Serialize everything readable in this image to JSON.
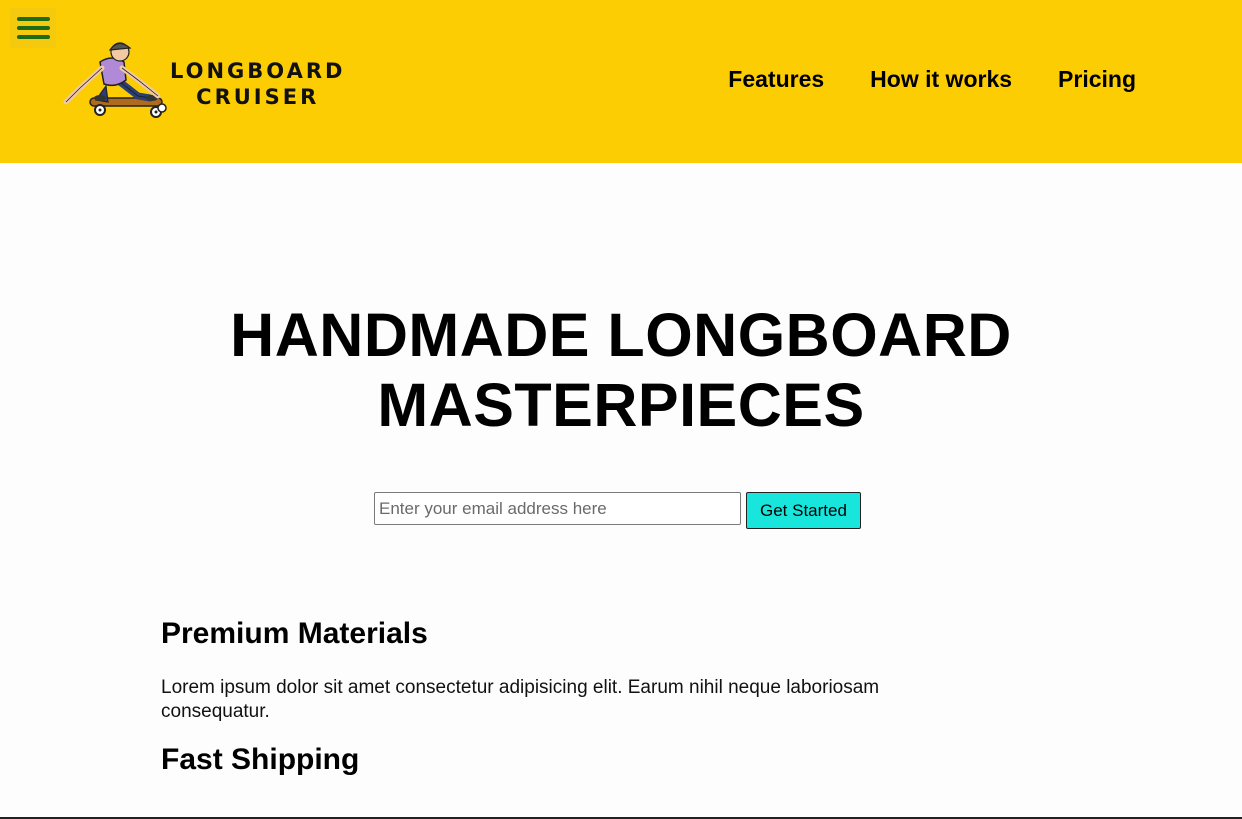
{
  "header": {
    "menu_icon": "hamburger-menu-icon",
    "logo": {
      "line1": "LONGBOARD",
      "line2": "CRUISER",
      "image": "longboard-rider-illustration"
    },
    "nav": [
      {
        "label": "Features"
      },
      {
        "label": "How it works"
      },
      {
        "label": "Pricing"
      }
    ]
  },
  "hero": {
    "title_line1": "HANDMADE LONGBOARD",
    "title_line2": "MASTERPIECES",
    "email_placeholder": "Enter your email address here",
    "cta_label": "Get Started"
  },
  "features": [
    {
      "title": "Premium Materials",
      "text": "Lorem ipsum dolor sit amet consectetur adipisicing elit. Earum nihil neque laboriosam consequatur."
    },
    {
      "title": "Fast Shipping",
      "text": ""
    }
  ],
  "colors": {
    "header_bg": "#fdcd04",
    "menu_icon": "#1e6b13",
    "cta_bg": "#18e6dd"
  }
}
